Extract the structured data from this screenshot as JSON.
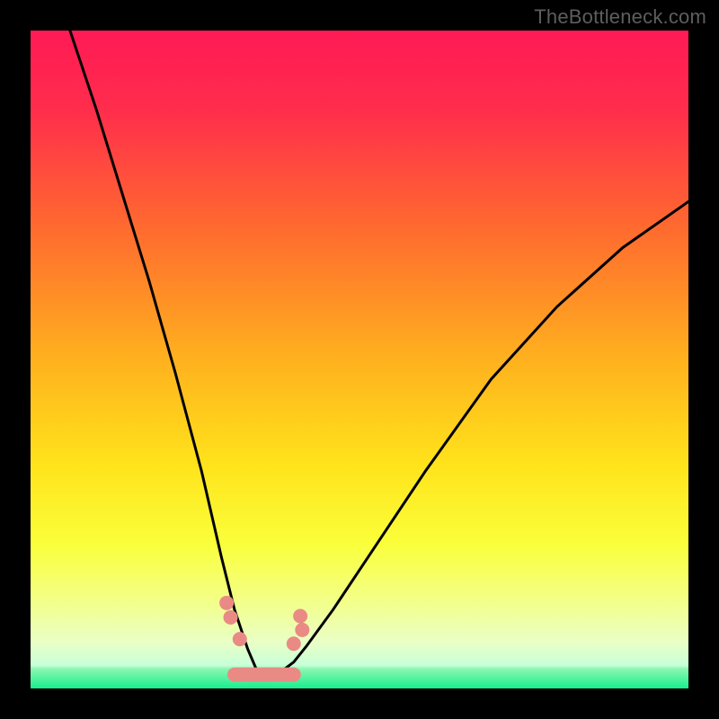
{
  "watermark": {
    "text": "TheBottleneck.com"
  },
  "chart_data": {
    "type": "line",
    "title": "",
    "xlabel": "",
    "ylabel": "",
    "xlim": [
      0,
      100
    ],
    "ylim": [
      0,
      100
    ],
    "grid": false,
    "legend": false,
    "note": "Values are approximate readings from the plotted curve (V-shaped bottleneck curve). x is horizontal position (percent of plot width), y is vertical position (percent of plot height, 0 = bottom green band, 100 = top red).",
    "series": [
      {
        "name": "bottleneck-curve",
        "x": [
          6,
          10,
          14,
          18,
          22,
          26,
          29,
          31,
          33,
          34.5,
          36,
          38,
          40,
          42,
          46,
          52,
          60,
          70,
          80,
          90,
          100
        ],
        "y": [
          100,
          88,
          75,
          62,
          48,
          33,
          20,
          12,
          6,
          2.5,
          2,
          2.5,
          4,
          6.5,
          12,
          21,
          33,
          47,
          58,
          67,
          74
        ]
      }
    ],
    "markers": {
      "name": "highlighted-dots",
      "color": "#e98b84",
      "points_note": "approximate cluster near the curve's minimum plus a thick bar along the trough",
      "x": [
        29.8,
        30.4,
        31.8,
        40.0,
        41.3,
        41.0
      ],
      "y": [
        13.0,
        10.8,
        7.5,
        6.8,
        8.9,
        11.0
      ],
      "bar_segment": {
        "x0": 31.0,
        "x1": 40.0,
        "y": 2.1
      }
    },
    "background_gradient": {
      "top_color": "#ff1a55",
      "mid_colors": [
        "#ff6a2f",
        "#ffd21c",
        "#f8ff47",
        "#eaffd0"
      ],
      "bottom_color": "#16ee8d",
      "bottom_band_height_pct": 3,
      "orientation": "vertical"
    }
  }
}
